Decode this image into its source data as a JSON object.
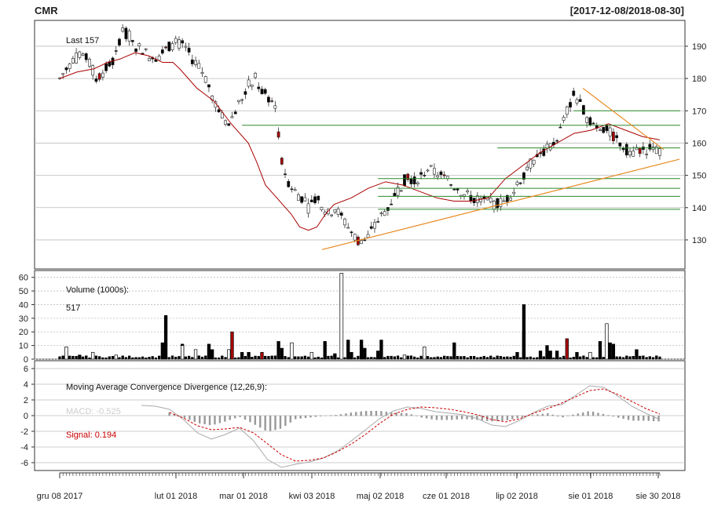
{
  "header": {
    "symbol": "CMR",
    "date_range": "[2017-12-08/2018-08-30]"
  },
  "chart_data": [
    {
      "type": "candlestick",
      "title": "CMR",
      "annotation": "Last 157",
      "ylim": [
        121,
        198
      ],
      "yticks": [
        130,
        140,
        150,
        160,
        170,
        180,
        190
      ],
      "grid": true,
      "bar_count": 182,
      "overlays": {
        "ma_line": [
          [
            0,
            180
          ],
          [
            10,
            182
          ],
          [
            20,
            183
          ],
          [
            28,
            185
          ],
          [
            35,
            186
          ],
          [
            44,
            188
          ],
          [
            52,
            187
          ],
          [
            60,
            185
          ],
          [
            66,
            185
          ],
          [
            70,
            183
          ],
          [
            80,
            177
          ],
          [
            90,
            173
          ],
          [
            100,
            166
          ],
          [
            110,
            160
          ],
          [
            115,
            154
          ],
          [
            120,
            147
          ],
          [
            125,
            144
          ],
          [
            130,
            141
          ],
          [
            135,
            138
          ],
          [
            140,
            134
          ],
          [
            145,
            133
          ],
          [
            150,
            134
          ],
          [
            155,
            138
          ],
          [
            160,
            141
          ],
          [
            170,
            143
          ],
          [
            180,
            146
          ],
          [
            190,
            148
          ],
          [
            200,
            147
          ],
          [
            210,
            145
          ],
          [
            220,
            143
          ],
          [
            230,
            142
          ],
          [
            240,
            142
          ],
          [
            250,
            143
          ],
          [
            255,
            146
          ],
          [
            260,
            149
          ],
          [
            270,
            153
          ],
          [
            280,
            157
          ],
          [
            290,
            160
          ],
          [
            300,
            163
          ],
          [
            310,
            164
          ],
          [
            320,
            166
          ],
          [
            330,
            164
          ],
          [
            340,
            162
          ],
          [
            350,
            161
          ]
        ],
        "horizontal_levels": [
          {
            "value": 165.5,
            "x_start": 55
          },
          {
            "value": 170,
            "x_start": 155
          },
          {
            "value": 158.5,
            "x_start": 132
          },
          {
            "value": 149,
            "x_start": 96
          },
          {
            "value": 146,
            "x_start": 96
          },
          {
            "value": 143.5,
            "x_start": 96
          },
          {
            "value": 139.5,
            "x_start": 96
          }
        ],
        "trendline_support": {
          "from": [
            94,
            127
          ],
          "to": [
            182,
            155
          ]
        },
        "trendline_resistance": {
          "from": [
            154,
            177
          ],
          "to": [
            181,
            158
          ]
        }
      },
      "candles_anchor": [
        [
          0,
          180
        ],
        [
          4,
          186
        ],
        [
          7,
          187
        ],
        [
          9,
          185
        ],
        [
          11,
          180
        ],
        [
          13,
          182
        ],
        [
          15,
          184
        ],
        [
          17,
          187
        ],
        [
          18,
          192
        ],
        [
          19,
          195
        ],
        [
          21,
          193
        ],
        [
          23,
          190
        ],
        [
          25,
          189
        ],
        [
          27,
          187
        ],
        [
          30,
          187
        ],
        [
          33,
          190
        ],
        [
          35,
          191
        ],
        [
          38,
          190
        ],
        [
          40,
          186
        ],
        [
          43,
          182
        ],
        [
          45,
          178
        ],
        [
          47,
          172
        ],
        [
          49,
          168
        ],
        [
          51,
          166
        ],
        [
          53,
          170
        ],
        [
          55,
          174
        ],
        [
          57,
          178
        ],
        [
          59,
          180
        ],
        [
          61,
          176
        ],
        [
          63,
          174
        ],
        [
          65,
          172
        ],
        [
          66,
          162
        ],
        [
          67,
          154
        ],
        [
          69,
          148
        ],
        [
          71,
          145
        ],
        [
          73,
          143
        ],
        [
          75,
          140
        ],
        [
          77,
          143
        ],
        [
          79,
          141
        ],
        [
          81,
          138
        ],
        [
          83,
          140
        ],
        [
          85,
          137
        ],
        [
          87,
          134
        ],
        [
          89,
          131
        ],
        [
          91,
          129
        ],
        [
          93,
          131
        ],
        [
          95,
          134
        ],
        [
          97,
          138
        ],
        [
          99,
          140
        ],
        [
          101,
          144
        ],
        [
          103,
          147
        ],
        [
          105,
          150
        ],
        [
          107,
          148
        ],
        [
          109,
          150
        ],
        [
          111,
          152
        ],
        [
          113,
          151
        ],
        [
          115,
          150
        ],
        [
          117,
          148
        ],
        [
          120,
          146
        ],
        [
          122,
          144
        ],
        [
          125,
          143
        ],
        [
          128,
          142
        ],
        [
          131,
          141
        ],
        [
          134,
          142
        ],
        [
          137,
          145
        ],
        [
          139,
          149
        ],
        [
          141,
          152
        ],
        [
          143,
          155
        ],
        [
          145,
          157
        ],
        [
          147,
          158
        ],
        [
          149,
          160
        ],
        [
          151,
          164
        ],
        [
          153,
          170
        ],
        [
          155,
          175
        ],
        [
          157,
          172
        ],
        [
          159,
          168
        ],
        [
          161,
          166
        ],
        [
          163,
          165
        ],
        [
          165,
          164
        ],
        [
          167,
          162
        ],
        [
          169,
          160
        ],
        [
          171,
          158
        ],
        [
          173,
          157
        ],
        [
          175,
          158
        ],
        [
          177,
          158
        ],
        [
          179,
          159
        ],
        [
          181,
          157
        ]
      ]
    },
    {
      "type": "bar",
      "title": "Volume (1000s):",
      "annotation": "517",
      "ylim": [
        0,
        65
      ],
      "yticks": [
        0,
        10,
        20,
        30,
        40,
        50,
        60
      ],
      "grid": true,
      "spikes": [
        {
          "x": 3,
          "v": 9
        },
        {
          "x": 10,
          "v": 3
        },
        {
          "x": 18,
          "v": 5
        },
        {
          "x": 30,
          "v": 3
        },
        {
          "x": 55,
          "v": 12
        },
        {
          "x": 56,
          "v": 32
        },
        {
          "x": 65,
          "v": 11
        },
        {
          "x": 66,
          "v": 10
        },
        {
          "x": 72,
          "v": 7
        },
        {
          "x": 80,
          "v": 11
        },
        {
          "x": 82,
          "v": 7
        },
        {
          "x": 90,
          "v": 7
        },
        {
          "x": 92,
          "v": 20
        },
        {
          "x": 98,
          "v": 5
        },
        {
          "x": 101,
          "v": 5
        },
        {
          "x": 108,
          "v": 5
        },
        {
          "x": 116,
          "v": 13
        },
        {
          "x": 118,
          "v": 8
        },
        {
          "x": 123,
          "v": 12
        },
        {
          "x": 135,
          "v": 5
        },
        {
          "x": 142,
          "v": 13
        },
        {
          "x": 146,
          "v": 4
        },
        {
          "x": 154,
          "v": 14
        },
        {
          "x": 155,
          "v": 5
        },
        {
          "x": 160,
          "v": 10
        },
        {
          "x": 161,
          "v": 14
        },
        {
          "x": 163,
          "v": 8
        },
        {
          "x": 170,
          "v": 6
        },
        {
          "x": 172,
          "v": 14
        },
        {
          "x": 183,
          "v": 3
        },
        {
          "x": 195,
          "v": 9
        },
        {
          "x": 211,
          "v": 12
        },
        {
          "x": 244,
          "v": 5
        },
        {
          "x": 247,
          "v": 20
        },
        {
          "x": 248,
          "v": 40
        },
        {
          "x": 256,
          "v": 6
        },
        {
          "x": 260,
          "v": 10
        },
        {
          "x": 262,
          "v": 6
        },
        {
          "x": 265,
          "v": 6
        },
        {
          "x": 270,
          "v": 15
        },
        {
          "x": 275,
          "v": 5
        },
        {
          "x": 282,
          "v": 5
        },
        {
          "x": 289,
          "v": 13
        },
        {
          "x": 291,
          "v": 26
        },
        {
          "x": 293,
          "v": 12
        },
        {
          "x": 295,
          "v": 11
        },
        {
          "x": 308,
          "v": 7
        }
      ]
    },
    {
      "type": "line",
      "title": "Moving Average Convergence Divergence (12,26,9):",
      "series": [
        {
          "name": "MACD: -0.525",
          "color": "#aaaaaa"
        },
        {
          "name": "Signal: 0.194",
          "color": "#cc0000"
        }
      ],
      "ylim": [
        -7,
        7
      ],
      "yticks": [
        -6,
        -4,
        -2,
        0,
        2,
        4,
        6
      ],
      "grid": true,
      "macd": [
        [
          0,
          1.3
        ],
        [
          10,
          1.2
        ],
        [
          20,
          0.8
        ],
        [
          30,
          -0.5
        ],
        [
          40,
          -2.2
        ],
        [
          50,
          -3
        ],
        [
          60,
          -2.4
        ],
        [
          70,
          -1.6
        ],
        [
          80,
          -3.2
        ],
        [
          90,
          -5.6
        ],
        [
          100,
          -6.6
        ],
        [
          110,
          -6.2
        ],
        [
          120,
          -5.9
        ],
        [
          130,
          -5.4
        ],
        [
          140,
          -4.5
        ],
        [
          150,
          -3.2
        ],
        [
          160,
          -1.8
        ],
        [
          170,
          -0.4
        ],
        [
          180,
          0.6
        ],
        [
          190,
          1.1
        ],
        [
          200,
          0.9
        ],
        [
          210,
          0.5
        ],
        [
          220,
          0.3
        ],
        [
          230,
          0.1
        ],
        [
          240,
          -0.4
        ],
        [
          250,
          -1.2
        ],
        [
          260,
          -1.4
        ],
        [
          270,
          -0.6
        ],
        [
          280,
          0.4
        ],
        [
          290,
          1.2
        ],
        [
          300,
          1.4
        ],
        [
          310,
          2.6
        ],
        [
          320,
          3.8
        ],
        [
          330,
          3.6
        ],
        [
          340,
          2.5
        ],
        [
          350,
          1.2
        ],
        [
          360,
          0.3
        ],
        [
          370,
          -0.5
        ]
      ],
      "signal": [
        [
          20,
          0.4
        ],
        [
          30,
          -0.3
        ],
        [
          40,
          -1.3
        ],
        [
          50,
          -1.8
        ],
        [
          60,
          -1.7
        ],
        [
          70,
          -1.5
        ],
        [
          80,
          -2.2
        ],
        [
          90,
          -3.6
        ],
        [
          100,
          -5
        ],
        [
          110,
          -5.8
        ],
        [
          120,
          -5.7
        ],
        [
          130,
          -5.4
        ],
        [
          140,
          -4.6
        ],
        [
          150,
          -3.6
        ],
        [
          160,
          -2.4
        ],
        [
          170,
          -1
        ],
        [
          180,
          0.2
        ],
        [
          190,
          0.8
        ],
        [
          200,
          1.1
        ],
        [
          210,
          1
        ],
        [
          220,
          0.8
        ],
        [
          230,
          0.5
        ],
        [
          240,
          0.1
        ],
        [
          250,
          -0.5
        ],
        [
          260,
          -0.8
        ],
        [
          270,
          -0.4
        ],
        [
          280,
          0.3
        ],
        [
          290,
          0.9
        ],
        [
          300,
          1.6
        ],
        [
          310,
          2.4
        ],
        [
          320,
          3.2
        ],
        [
          330,
          3.4
        ],
        [
          340,
          2.7
        ],
        [
          350,
          1.8
        ],
        [
          360,
          0.9
        ],
        [
          370,
          0.2
        ]
      ],
      "histogram_note": "gray bars = MACD - Signal"
    }
  ],
  "x_axis": {
    "tick_labels": [
      "gru 08 2017",
      "lut 01 2018",
      "mar 01 2018",
      "kwi 03 2018",
      "maj 02 2018",
      "cze 01 2018",
      "lip 02 2018",
      "sie 01 2018",
      "sie 30 2018"
    ]
  },
  "colors": {
    "down_fill": "#000000",
    "up_fill": "#ffffff",
    "flagged_fill": "#aa0000",
    "ma_color": "#aa0000",
    "level_color": "#2a8a2a",
    "trend_color": "#e88a20",
    "grid": "#bbbbbb"
  }
}
